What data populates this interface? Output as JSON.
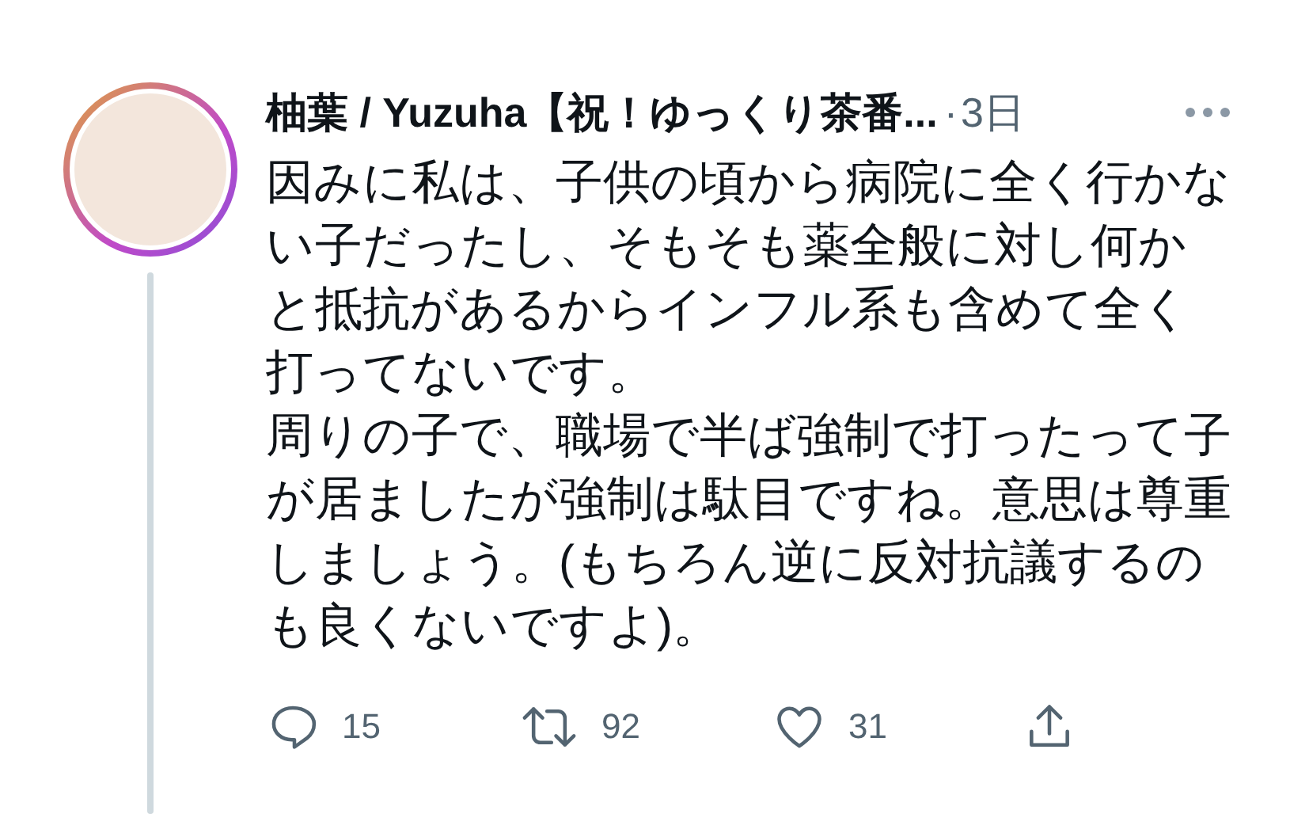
{
  "tweet": {
    "author_name": "柚葉 / Yuzuha【祝！ゆっくり茶番...",
    "separator": "·",
    "time": "3日",
    "paragraphs": [
      "因みに私は、子供の頃から病院に全く行かない子だったし、そもそも薬全般に対し何かと抵抗があるからインフル系も含めて全く打ってないです。",
      "周りの子で、職場で半ば強制で打ったって子が居ましたが強制は駄目ですね。意思は尊重しましょう。(もちろん逆に反対抗議するのも良くないですよ)。"
    ],
    "actions": [
      {
        "kind": "reply",
        "count": "15"
      },
      {
        "kind": "retweet",
        "count": "92"
      },
      {
        "kind": "like",
        "count": "31"
      },
      {
        "kind": "share"
      }
    ]
  }
}
